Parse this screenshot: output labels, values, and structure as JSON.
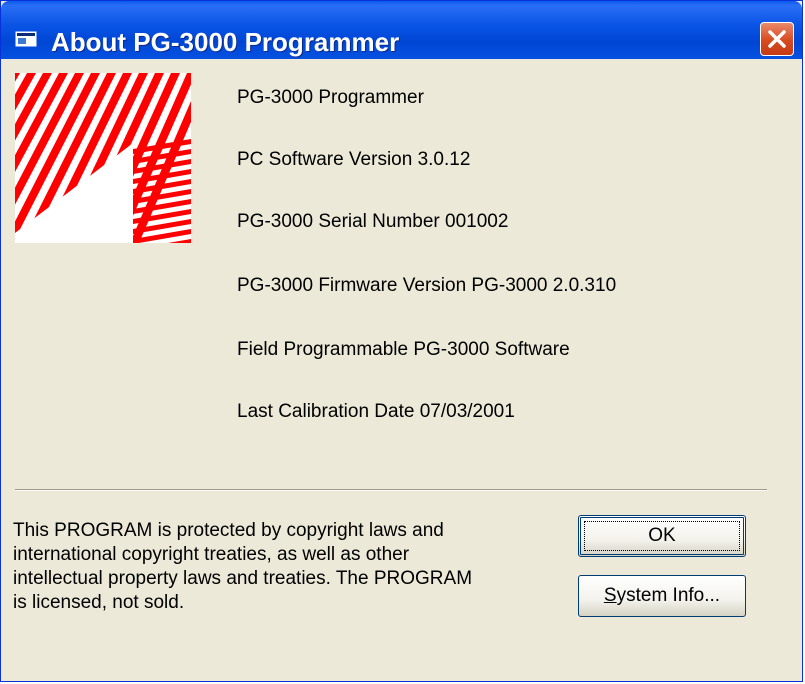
{
  "window": {
    "title": "About PG-3000 Programmer"
  },
  "info": {
    "product_name": "PG-3000 Programmer",
    "software_version": "PC Software Version 3.0.12",
    "serial_number": "PG-3000 Serial Number 001002",
    "firmware_version": "PG-3000 Firmware Version PG-3000 2.0.310",
    "field_programmable": "Field Programmable PG-3000 Software",
    "calibration_date": "Last Calibration Date 07/03/2001"
  },
  "copyright": {
    "line1": "This PROGRAM is protected by copyright laws and",
    "line2": "international copyright treaties, as well as other",
    "line3": "intellectual property laws and treaties. The PROGRAM",
    "line4": "is licensed, not sold."
  },
  "buttons": {
    "ok_label": "OK",
    "system_info_first": "S",
    "system_info_rest": "ystem Info..."
  },
  "colors": {
    "titlebar": "#0054e3",
    "logo_stripes": "#ff0000",
    "dialog_bg": "#ece9d8"
  },
  "icons": {
    "app": "window-icon",
    "close": "close-x-icon"
  }
}
